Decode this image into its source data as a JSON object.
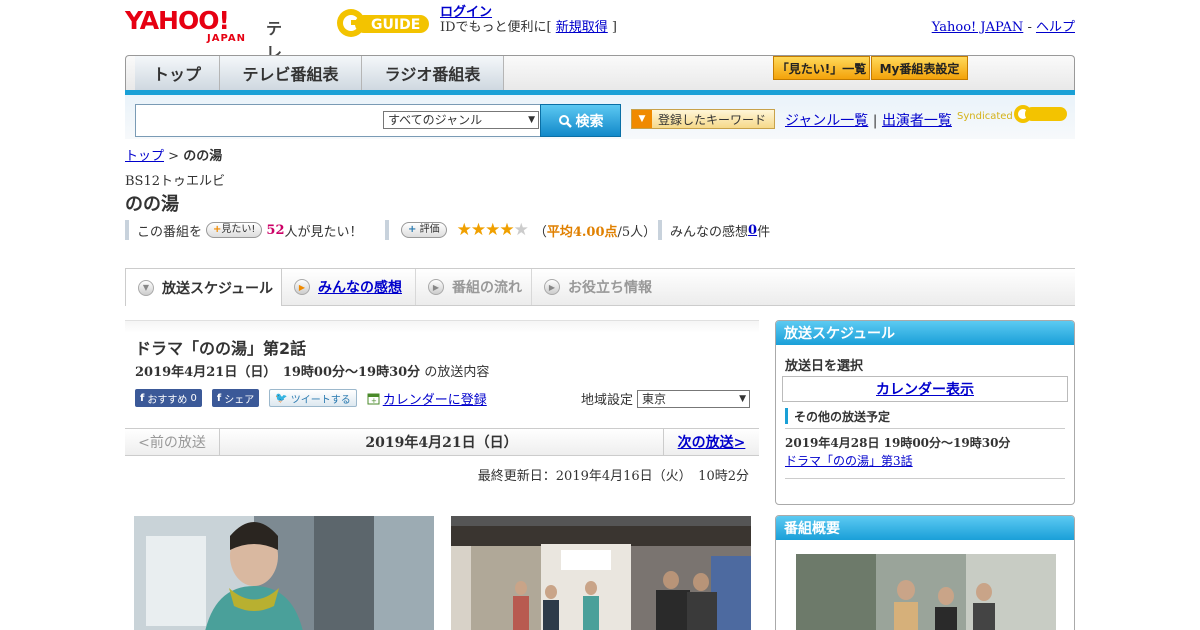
{
  "header": {
    "logo_yahoo": "YAHOO!",
    "logo_japan": "JAPAN",
    "logo_tv": "テレビ",
    "gguide": "GUIDE",
    "login_label": "ログイン",
    "login_sub_prefix": "IDでもっと便利に[ ",
    "register_label": "新規取得",
    "login_sub_suffix": " ]",
    "yahoo_japan_link": "Yahoo! JAPAN",
    "separator": " - ",
    "help_link": "ヘルプ"
  },
  "nav": {
    "tabs": [
      "トップ",
      "テレビ番組表",
      "ラジオ番組表"
    ],
    "want_list": "「見たい!」一覧",
    "my_guide": "My番組表設定"
  },
  "search": {
    "genre_selected": "すべてのジャンル",
    "search_button": "検索",
    "keyword_button": "登録したキーワード",
    "genre_list_link": "ジャンル一覧",
    "pipe": " | ",
    "performer_list_link": "出演者一覧",
    "syndicated": "Syndicated"
  },
  "breadcrumb": {
    "top": "トップ",
    "sep": " > ",
    "current": "のの湯"
  },
  "program": {
    "channel": "BS12トゥエルビ",
    "title": "のの湯",
    "want_prefix": "この番組を",
    "want_button": "見たい!",
    "want_count": "52",
    "want_suffix": "人が見たい！",
    "rate_button": "評価",
    "rating_value": 4.0,
    "rating_open": "（",
    "rating_avg_label": "平均4.00点",
    "rating_people": "/5人）",
    "impressions_label": "みんなの感想 ",
    "impressions_count": "0",
    "impressions_suffix": "件"
  },
  "content_tabs": [
    "放送スケジュール",
    "みんなの感想",
    "番組の流れ",
    "お役立ち情報"
  ],
  "episode": {
    "title": "ドラマ「のの湯」第2話",
    "date_bold": "2019年4月21日（日）　19時00分～19時30分",
    "date_suffix": "の放送内容",
    "recommend": "おすすめ",
    "recommend_count": "0",
    "share": "シェア",
    "tweet": "ツイートする",
    "calendar_link": "カレンダーに登録",
    "region_label": "地域設定",
    "region_value": "東京"
  },
  "pager": {
    "prev": "<前の放送",
    "current": "2019年4月21日（日）",
    "next": "次の放送>"
  },
  "updated": "最終更新日：2019年4月16日（火）　10時2分",
  "sidebar": {
    "schedule_head": "放送スケジュール",
    "select_date": "放送日を選択",
    "calendar_button": "カレンダー表示",
    "other_head": "その他の放送予定",
    "other_date": "2019年4月28日  19時00分～19時30分",
    "other_title": "ドラマ「のの湯」第3話",
    "overview_head": "番組概要"
  }
}
